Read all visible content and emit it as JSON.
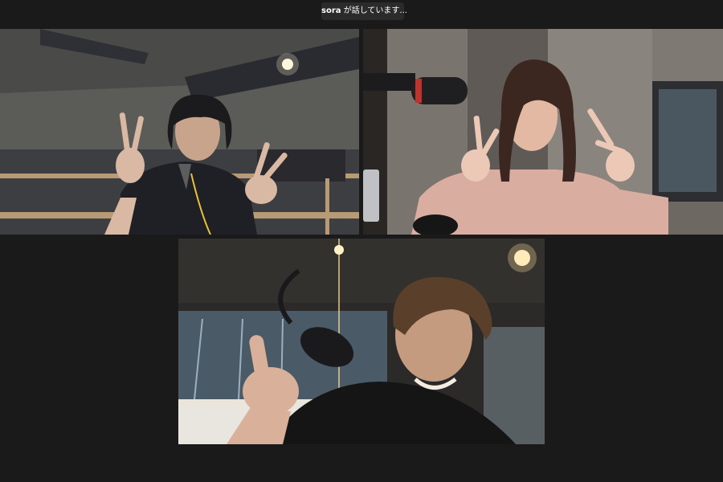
{
  "speaking_indicator": {
    "speaker": "sora",
    "suffix": " が話しています..."
  },
  "participants": [
    {
      "tile": "video-tile-1"
    },
    {
      "tile": "video-tile-2"
    },
    {
      "tile": "video-tile-3",
      "active_speaker": true
    }
  ],
  "colors": {
    "background": "#1a1a1a",
    "banner": "#2b2b2b"
  }
}
